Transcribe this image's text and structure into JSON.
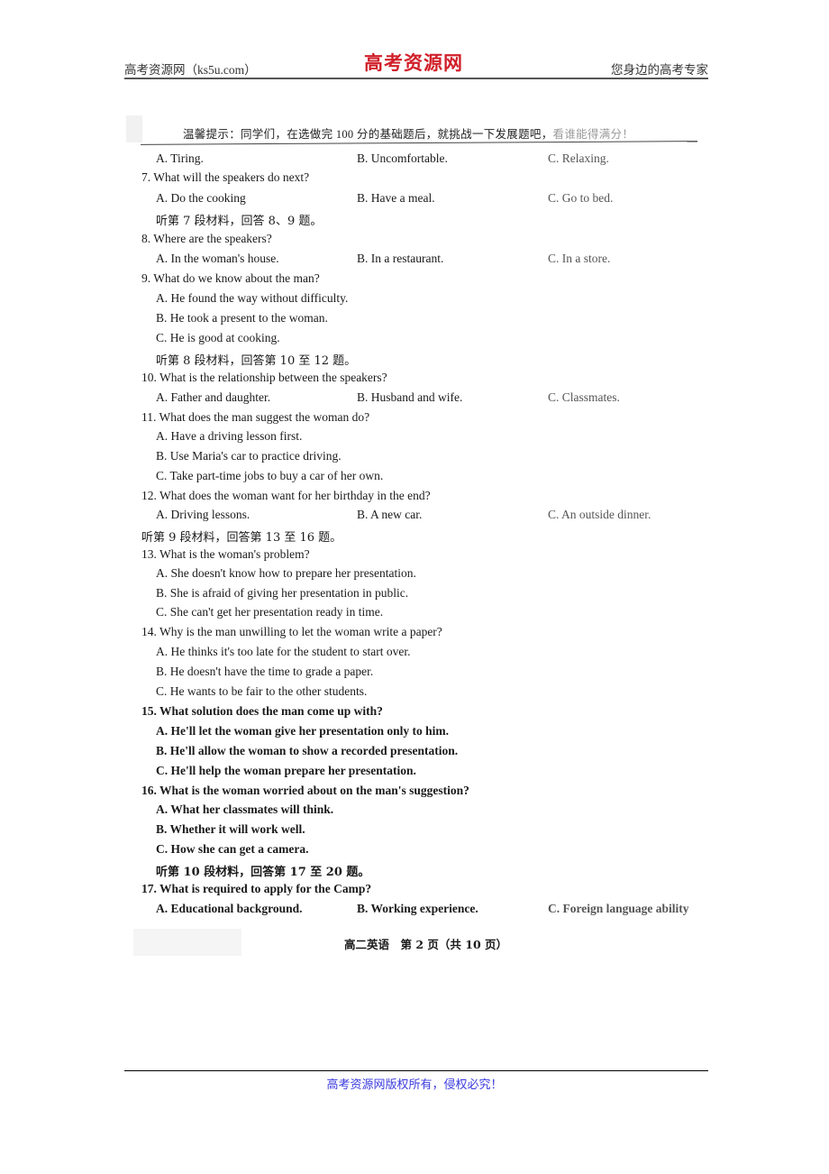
{
  "header": {
    "left": "高考资源网（ks5u.com）",
    "center": "高考资源网",
    "right": "您身边的高考专家"
  },
  "tip": {
    "text": "温馨提示：同学们，在选做完 100 分的基础题后，就挑战一下发展题吧，",
    "faded": "看谁能得满分！"
  },
  "lines": [
    {
      "type": "options",
      "A": "A. Tiring.",
      "B": "B. Uncomfortable.",
      "C": "C. Relaxing."
    },
    {
      "type": "question",
      "text": "7. What will the speakers do next?"
    },
    {
      "type": "options",
      "A": "A. Do the cooking",
      "B": "B. Have a meal.",
      "C": "C. Go to bed."
    },
    {
      "type": "instruction",
      "text": "听第 7 段材料，回答 8、9 题。"
    },
    {
      "type": "question",
      "text": "8. Where are the speakers?"
    },
    {
      "type": "options",
      "A": "A. In the woman's house.",
      "B": "B. In a restaurant.",
      "C": "C. In a store."
    },
    {
      "type": "question",
      "text": "9. What do we know about the man?"
    },
    {
      "type": "option",
      "text": "A. He found the way without difficulty."
    },
    {
      "type": "option",
      "text": "B. He took a present to the woman."
    },
    {
      "type": "option",
      "text": "C. He is good at cooking."
    },
    {
      "type": "instruction",
      "text": "听第 8 段材料，回答第 10 至 12 题。"
    },
    {
      "type": "question",
      "text": "10. What is the relationship between the speakers?"
    },
    {
      "type": "options",
      "A": "A. Father and daughter.",
      "B": "B. Husband and wife.",
      "C": "C. Classmates."
    },
    {
      "type": "question",
      "text": "11. What does the man suggest the woman do?"
    },
    {
      "type": "option",
      "text": "A. Have a driving lesson first."
    },
    {
      "type": "option",
      "text": "B. Use Maria's car to practice driving."
    },
    {
      "type": "option",
      "text": "C. Take part-time jobs to buy a car of her own."
    },
    {
      "type": "question",
      "text": "12. What does the woman want for her birthday in the end?"
    },
    {
      "type": "options",
      "A": "A. Driving lessons.",
      "B": "B. A new car.",
      "C": "C. An outside dinner."
    },
    {
      "type": "instruction2",
      "text": "听第 9 段材料，回答第 13 至 16 题。"
    },
    {
      "type": "question",
      "text": "13. What is the woman's problem?"
    },
    {
      "type": "option",
      "text": "A. She doesn't know how to prepare her presentation."
    },
    {
      "type": "option",
      "text": "B. She is afraid of giving her presentation in public."
    },
    {
      "type": "option",
      "text": "C. She can't get her presentation ready in time."
    },
    {
      "type": "question",
      "text": "14. Why is the man unwilling to let the woman write a paper?"
    },
    {
      "type": "option",
      "text": "A. He thinks it's too late for the student to start over."
    },
    {
      "type": "option",
      "text": "B. He doesn't have the time to grade a paper."
    },
    {
      "type": "option",
      "text": "C. He wants to be fair to the other students."
    },
    {
      "type": "question",
      "text": "15. What solution does the man come up with?"
    },
    {
      "type": "option",
      "text": "A. He'll let the woman give her presentation only to him."
    },
    {
      "type": "option",
      "text": "B. He'll allow the woman to show a recorded presentation."
    },
    {
      "type": "option",
      "text": "C. He'll help the woman prepare her presentation."
    },
    {
      "type": "question",
      "text": "16. What is the woman worried about on the man's suggestion?"
    },
    {
      "type": "option",
      "text": "A. What her classmates will think."
    },
    {
      "type": "option",
      "text": "B. Whether it will work well."
    },
    {
      "type": "option",
      "text": "C. How she can get a camera."
    },
    {
      "type": "instruction",
      "text": "听第 10 段材料，回答第 17 至 20 题。"
    },
    {
      "type": "question",
      "text": "17. What is required to apply for the Camp?"
    },
    {
      "type": "options",
      "A": "A. Educational background.",
      "B": "B. Working experience.",
      "C": "C. Foreign language ability"
    }
  ],
  "page_number": "高二英语　第 2 页（共 10 页）",
  "footer": "高考资源网版权所有，侵权必究！"
}
